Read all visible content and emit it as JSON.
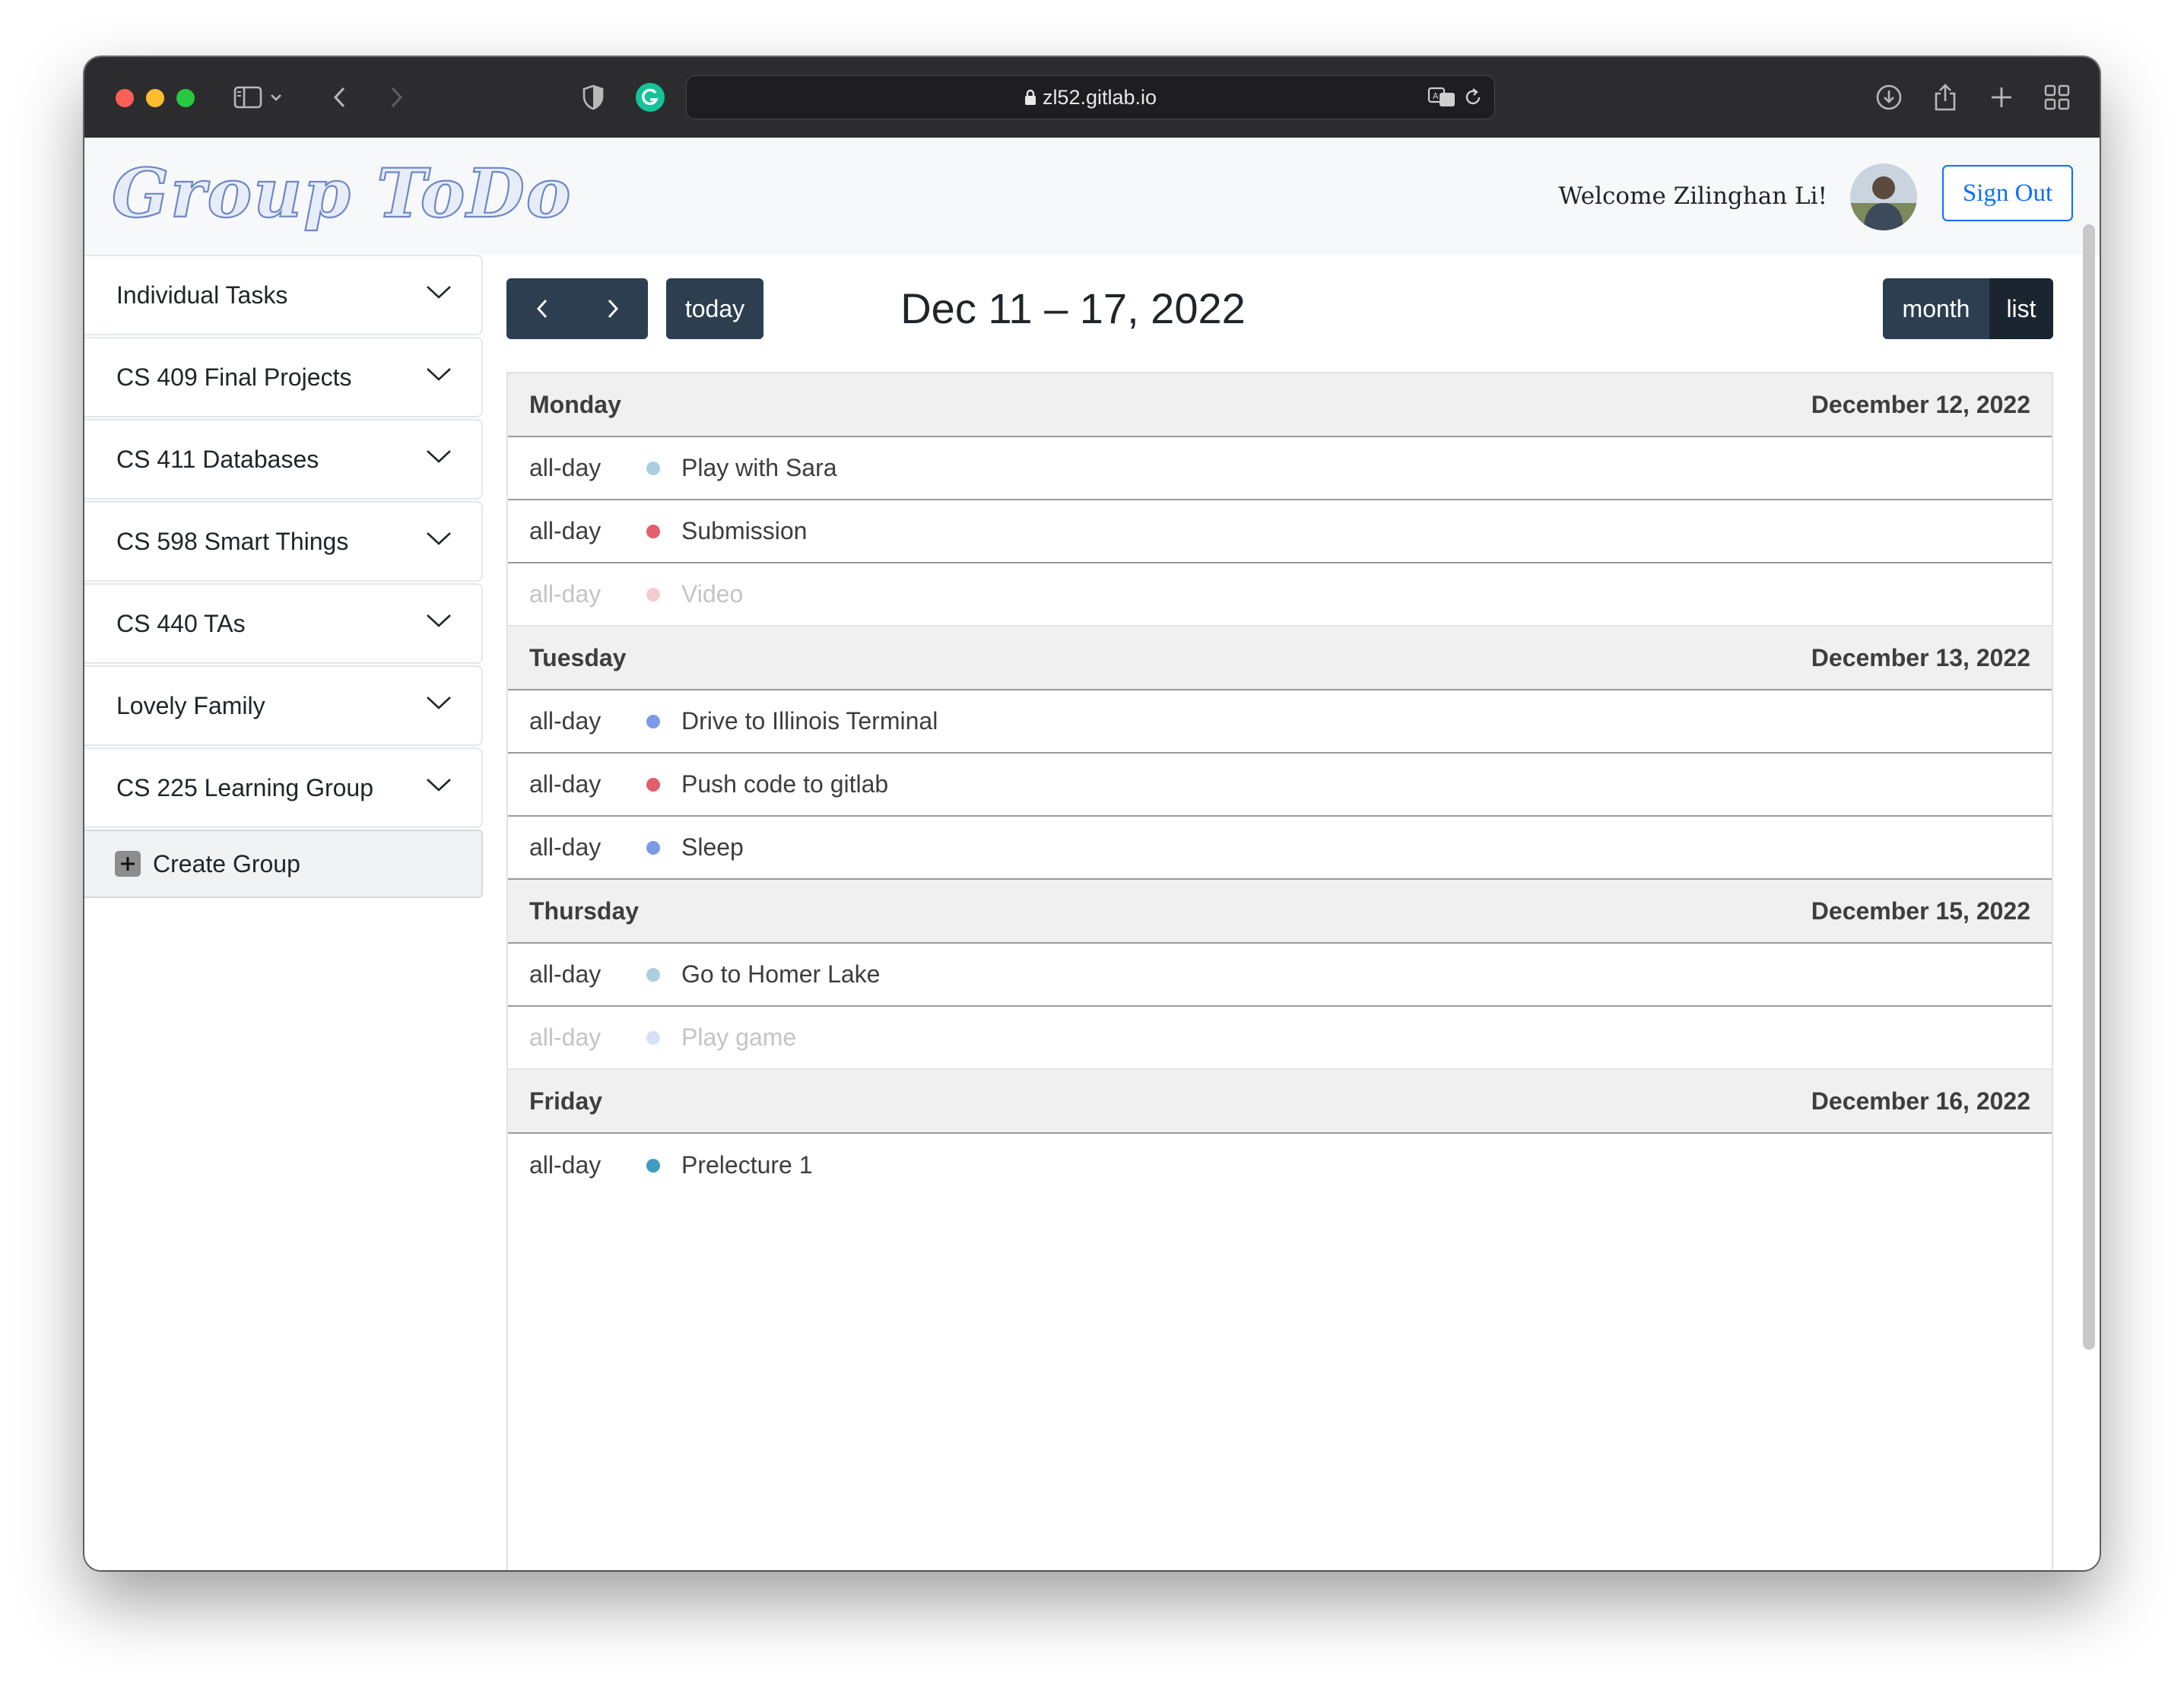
{
  "browser": {
    "url": "zl52.gitlab.io"
  },
  "header": {
    "logo_text": "Group ToDo",
    "welcome": "Welcome Zilinghan Li!",
    "sign_out": "Sign Out"
  },
  "sidebar": {
    "groups": [
      {
        "label": "Individual Tasks"
      },
      {
        "label": "CS 409 Final Projects"
      },
      {
        "label": "CS 411 Databases"
      },
      {
        "label": "CS 598 Smart Things"
      },
      {
        "label": "CS 440 TAs"
      },
      {
        "label": "Lovely Family"
      },
      {
        "label": "CS 225 Learning Group"
      }
    ],
    "create_group": "Create Group"
  },
  "calendar": {
    "today": "today",
    "title": "Dec 11 – 17, 2022",
    "view_month": "month",
    "view_list": "list",
    "days": [
      {
        "weekday": "Monday",
        "date": "December 12, 2022",
        "events": [
          {
            "time": "all-day",
            "title": "Play with Sara",
            "color": "#a9cfe0",
            "faded": false
          },
          {
            "time": "all-day",
            "title": "Submission",
            "color": "#e35d6a",
            "faded": false
          },
          {
            "time": "all-day",
            "title": "Video",
            "color": "#f5cbd0",
            "faded": true
          }
        ]
      },
      {
        "weekday": "Tuesday",
        "date": "December 13, 2022",
        "events": [
          {
            "time": "all-day",
            "title": "Drive to Illinois Terminal",
            "color": "#7b9be6",
            "faded": false
          },
          {
            "time": "all-day",
            "title": "Push code to gitlab",
            "color": "#e35d6a",
            "faded": false
          },
          {
            "time": "all-day",
            "title": "Sleep",
            "color": "#7b9be6",
            "faded": false
          }
        ]
      },
      {
        "weekday": "Thursday",
        "date": "December 15, 2022",
        "events": [
          {
            "time": "all-day",
            "title": "Go to Homer Lake",
            "color": "#a9cfe0",
            "faded": false
          },
          {
            "time": "all-day",
            "title": "Play game",
            "color": "#d6e1f7",
            "faded": true
          }
        ]
      },
      {
        "weekday": "Friday",
        "date": "December 16, 2022",
        "events": [
          {
            "time": "all-day",
            "title": "Prelecture 1",
            "color": "#3f9bc2",
            "faded": false
          }
        ]
      }
    ]
  }
}
